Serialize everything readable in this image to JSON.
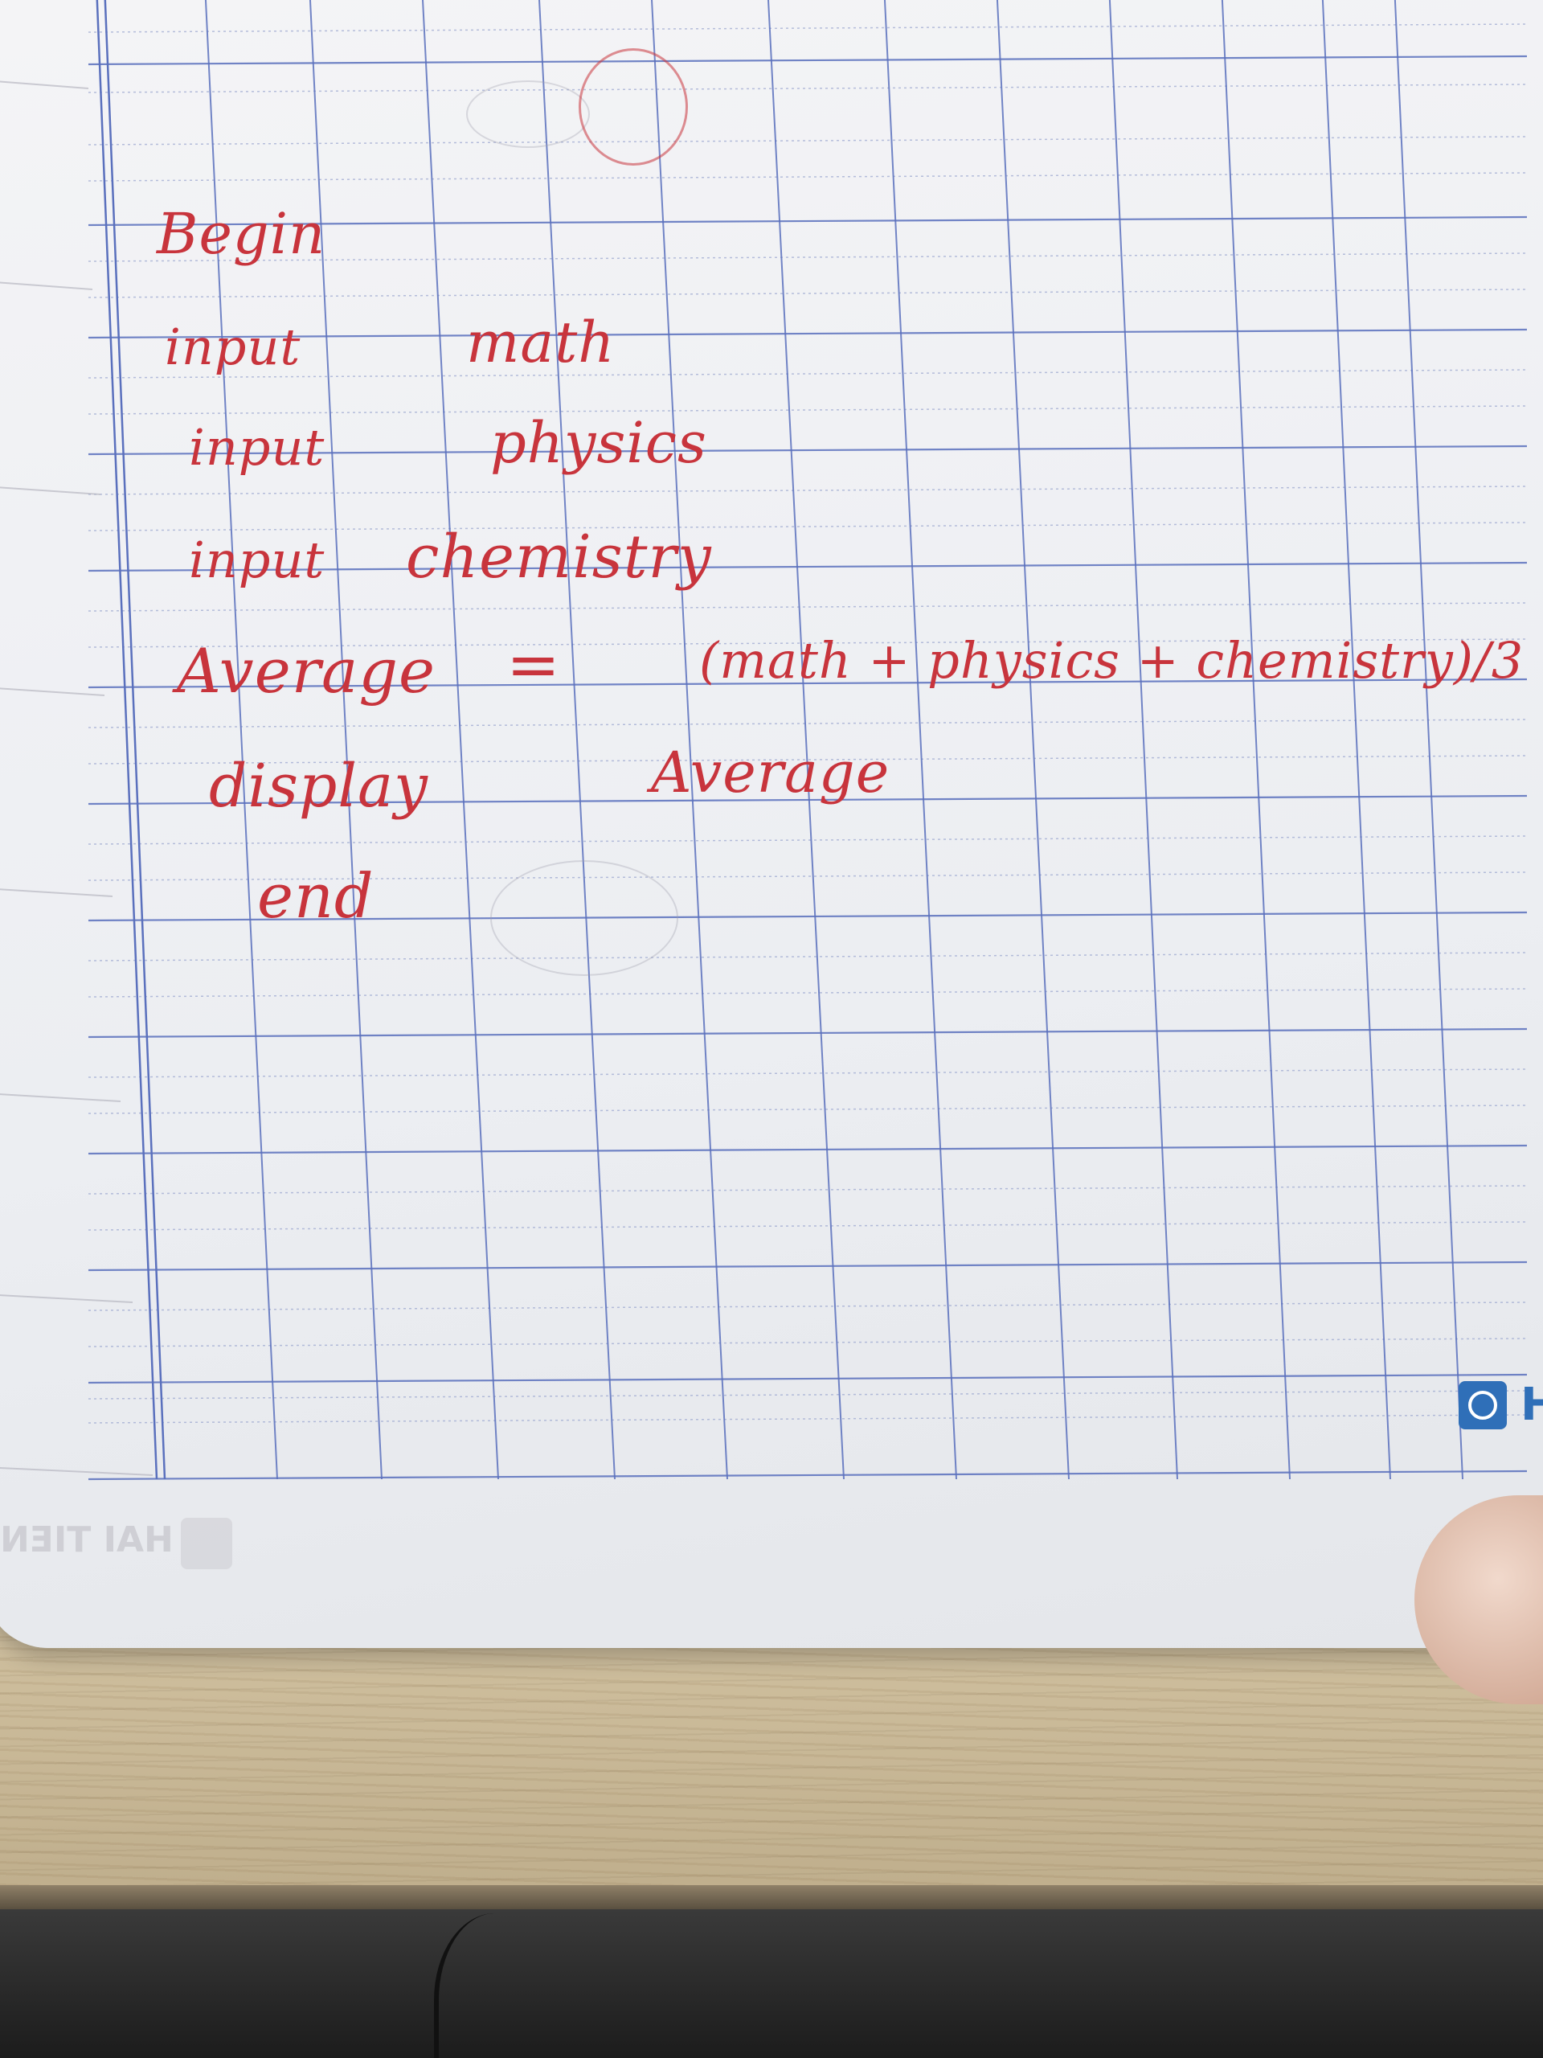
{
  "photo": {
    "subject": "notebook-page",
    "ink_color": "#c8343c",
    "grid_color": "#3a57b0",
    "handwriting": {
      "line_begin": "Begin",
      "line_input_1_keyword": "input",
      "line_input_1_value": "math",
      "line_input_2_keyword": "input",
      "line_input_2_value": "physics",
      "line_input_3_keyword": "input",
      "line_input_3_value": "chemistry",
      "line_average_name": "Average",
      "line_average_equals": "=",
      "line_average_formula": "(math + physics + chemistry)/3",
      "line_display_keyword": "display",
      "line_display_value": "Average",
      "line_end": "end"
    },
    "brand": {
      "corner_letter": "H",
      "mirrored_text": "HAI TIEN"
    }
  }
}
